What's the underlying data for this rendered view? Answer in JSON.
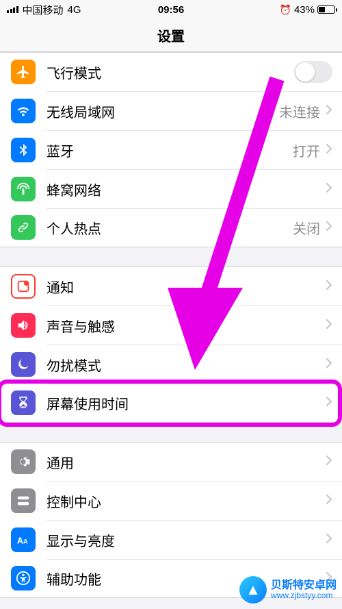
{
  "status": {
    "carrier": "中国移动",
    "network": "4G",
    "time": "09:56",
    "battery_pct": "43%",
    "battery_fill_pct": 43
  },
  "nav": {
    "title": "设置"
  },
  "groups": [
    {
      "rows": [
        {
          "key": "airplane",
          "label": "飞行模式",
          "icon": "airplane-icon",
          "bg": "bg-orange",
          "accessory": "toggle",
          "toggle_on": false
        },
        {
          "key": "wifi",
          "label": "无线局域网",
          "icon": "wifi-icon",
          "bg": "bg-blue",
          "accessory": "value-chevron",
          "value": "未连接"
        },
        {
          "key": "bluetooth",
          "label": "蓝牙",
          "icon": "bluetooth-icon",
          "bg": "bg-blue",
          "accessory": "value-chevron",
          "value": "打开"
        },
        {
          "key": "cellular",
          "label": "蜂窝网络",
          "icon": "antenna-icon",
          "bg": "bg-green",
          "accessory": "chevron"
        },
        {
          "key": "hotspot",
          "label": "个人热点",
          "icon": "link-icon",
          "bg": "bg-greenlink",
          "accessory": "value-chevron",
          "value": "关闭"
        }
      ]
    },
    {
      "rows": [
        {
          "key": "notifications",
          "label": "通知",
          "icon": "notification-icon",
          "bg": "bg-redbox",
          "accessory": "chevron"
        },
        {
          "key": "sounds",
          "label": "声音与触感",
          "icon": "speaker-icon",
          "bg": "bg-pink",
          "accessory": "chevron"
        },
        {
          "key": "dnd",
          "label": "勿扰模式",
          "icon": "moon-icon",
          "bg": "bg-indigo",
          "accessory": "chevron"
        },
        {
          "key": "screentime",
          "label": "屏幕使用时间",
          "icon": "hourglass-icon",
          "bg": "bg-indigo",
          "accessory": "chevron"
        }
      ]
    },
    {
      "rows": [
        {
          "key": "general",
          "label": "通用",
          "icon": "gear-icon",
          "bg": "bg-gray",
          "accessory": "chevron"
        },
        {
          "key": "controlcenter",
          "label": "控制中心",
          "icon": "switches-icon",
          "bg": "bg-gray",
          "accessory": "chevron"
        },
        {
          "key": "display",
          "label": "显示与亮度",
          "icon": "text-size-icon",
          "bg": "bg-bluebox",
          "accessory": "chevron"
        },
        {
          "key": "accessibility",
          "label": "辅助功能",
          "icon": "accessibility-icon",
          "bg": "bg-bluebox",
          "accessory": "chevron"
        }
      ]
    }
  ],
  "annotation": {
    "highlight_row_key": "screentime",
    "arrow_color": "#e600e6"
  },
  "watermark": {
    "line1": "贝斯特安卓网",
    "line2": "www.zjbstyy.com"
  }
}
